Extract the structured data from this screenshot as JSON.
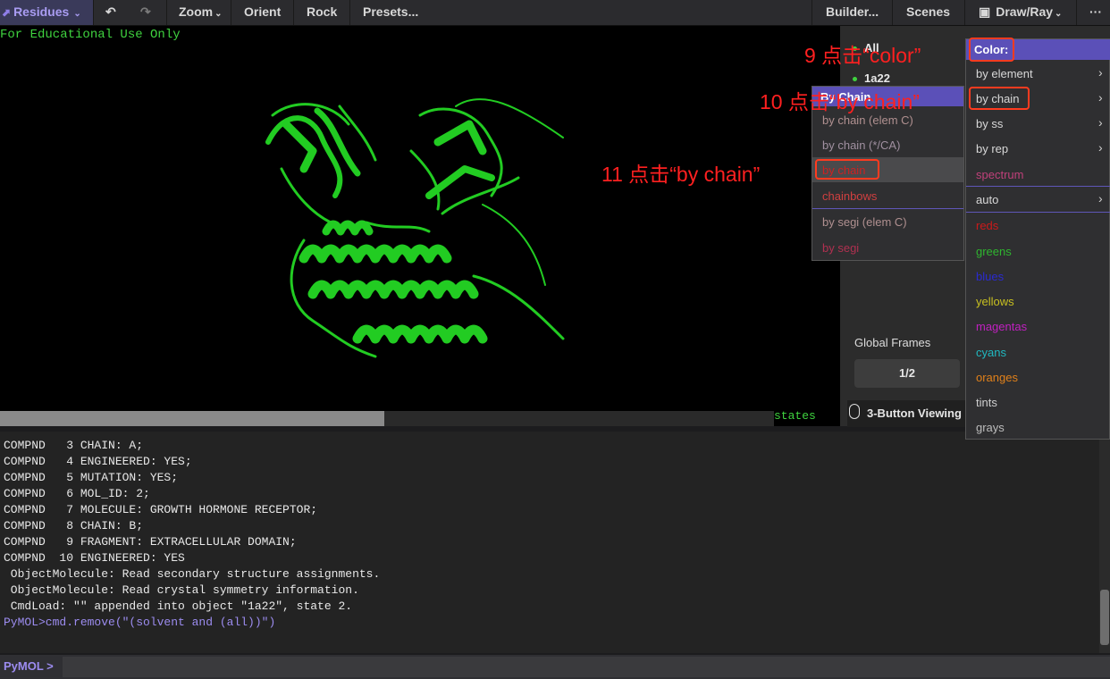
{
  "toolbar": {
    "residues": "Residues",
    "zoom": "Zoom",
    "orient": "Orient",
    "rock": "Rock",
    "presets": "Presets...",
    "builder": "Builder...",
    "scenes": "Scenes",
    "drawray": "Draw/Ray",
    "more": "···"
  },
  "viewport": {
    "edu_text": "For Educational Use Only",
    "states": "states",
    "molecule_color": "#22cc22"
  },
  "objects": {
    "all": "All",
    "item": "1a22",
    "global_frames": "Global Frames",
    "frame_value": "1/2",
    "mouse_mode": "3-Button Viewing"
  },
  "console": {
    "lines": [
      "COMPND   3 CHAIN: A;",
      "COMPND   4 ENGINEERED: YES;",
      "COMPND   5 MUTATION: YES;",
      "COMPND   6 MOL_ID: 2;",
      "COMPND   7 MOLECULE: GROWTH HORMONE RECEPTOR;",
      "COMPND   8 CHAIN: B;",
      "COMPND   9 FRAGMENT: EXTRACELLULAR DOMAIN;",
      "COMPND  10 ENGINEERED: YES",
      " ObjectMolecule: Read secondary structure assignments.",
      " ObjectMolecule: Read crystal symmetry information.",
      " CmdLoad: \"\" appended into object \"1a22\", state 2."
    ],
    "last_command": "PyMOL>cmd.remove(\"(solvent and (all))\")"
  },
  "cmdline": {
    "prompt": "PyMOL >",
    "value": ""
  },
  "color_menu": {
    "title": "Color:",
    "items": {
      "by_element": "by element",
      "by_chain": "by chain",
      "by_ss": "by ss",
      "by_rep": "by rep",
      "spectrum": "spectrum",
      "auto": "auto",
      "reds": "reds",
      "greens": "greens",
      "blues": "blues",
      "yellows": "yellows",
      "magentas": "magentas",
      "cyans": "cyans",
      "oranges": "oranges",
      "tints": "tints",
      "grays": "grays"
    },
    "colors": {
      "reds": "#cc1a1a",
      "greens": "#2fb52f",
      "blues": "#2a2ad0",
      "yellows": "#c8c020",
      "magentas": "#c020c0",
      "cyans": "#20b8c0",
      "oranges": "#e0801a",
      "tints": "#d0d0d0",
      "grays": "#bcbcbc"
    }
  },
  "chain_menu": {
    "title": "By Chain",
    "items": {
      "elem_c": "by chain (elem C)",
      "ca": "by chain (*/CA)",
      "by_chain": "by chain",
      "chainbows": "chainbows",
      "segi_elem": "by segi  (elem C)",
      "by_segi": "by segi"
    },
    "highlight_color": "#cc2222"
  },
  "annotations": {
    "step9": "9 点击“color”",
    "step10": "10 点击“by chain”",
    "step11": "11 点击“by chain”"
  }
}
